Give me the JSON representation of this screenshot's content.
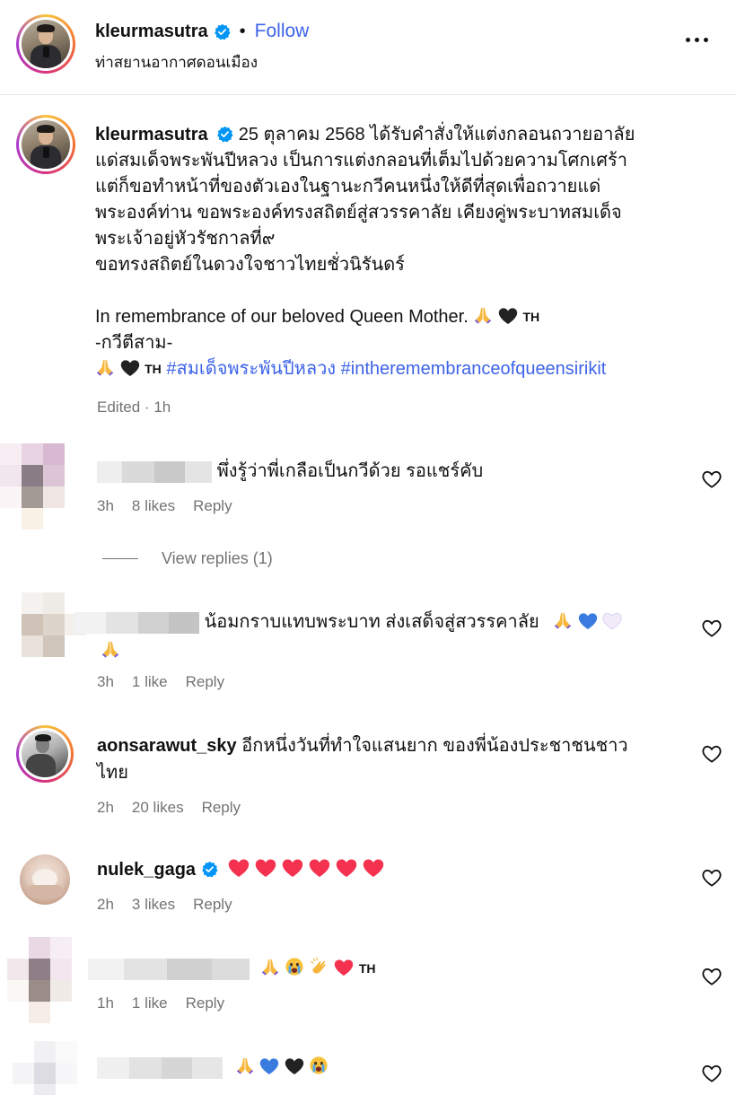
{
  "post": {
    "username": "kleurmasutra",
    "follow_label": "Follow",
    "separator": "•",
    "location": "ท่าสยานอากาศดอนเมือง"
  },
  "caption": {
    "username": "kleurmasutra",
    "lines": [
      "25 ตุลาคม 2568 ได้รับคำสั่งให้แต่งกลอนถวายอาลัย",
      "แด่สมเด็จพระพันปีหลวง เป็นการแต่งกลอนที่เต็มไปด้วยความโศกเศร้า",
      "แต่ก็ขอทำหน้าที่ของตัวเองในฐานะกวีคนหนึ่งให้ดีที่สุดเพื่อถวายแด่",
      "พระองค์ท่าน ขอพระองค์ทรงสถิตย์สู่สวรรคาลัย เคียงคู่พระบาทสมเด็จ",
      "พระเจ้าอยู่หัวรัชกาลที่๙",
      "ขอทรงสถิตย์ในดวงใจชาวไทยชั่วนิรันดร์"
    ],
    "english_line": "In remembrance of our beloved Queen Mother.",
    "signature": "-กวีตีสาม-",
    "th_flag": "TH",
    "hashtags": [
      "#สมเด็จพระพันปีหลวง",
      "#intheremembranceofqueensirikit"
    ],
    "edited": "Edited",
    "time": "1h"
  },
  "comments": [
    {
      "text": "พึ่งรู้ว่าพี่เกลือเป็นกวีด้วย รอแชร์คับ",
      "time": "3h",
      "likes": "8 likes",
      "reply": "Reply"
    },
    {
      "text": "น้อมกราบแทบพระบาท ส่งเสด็จสู่สวรรคาลัย",
      "time": "3h",
      "likes": "1 like",
      "reply": "Reply"
    },
    {
      "username": "aonsarawut_sky",
      "text": "อีกหนึ่งวันที่ทำใจแสนยาก ของพี่น้องประชาชนชาว",
      "text2": "ไทย",
      "time": "2h",
      "likes": "20 likes",
      "reply": "Reply"
    },
    {
      "username": "nulek_gaga",
      "time": "2h",
      "likes": "3 likes",
      "reply": "Reply"
    },
    {
      "th_flag": "TH",
      "time": "1h",
      "likes": "1 like",
      "reply": "Reply"
    },
    {}
  ],
  "view_replies": "View replies (1)",
  "colors": {
    "link": "#3d63e8",
    "verified": "#0095f6",
    "meta": "#737373",
    "heart": "#f4314f"
  },
  "icons": [
    "verified-icon",
    "more-options-icon",
    "heart-outline-icon",
    "praying-hands-emoji",
    "black-heart-emoji",
    "red-heart-emoji",
    "blue-heart-emoji",
    "white-heart-emoji",
    "crying-face-emoji",
    "clapping-hands-emoji"
  ]
}
